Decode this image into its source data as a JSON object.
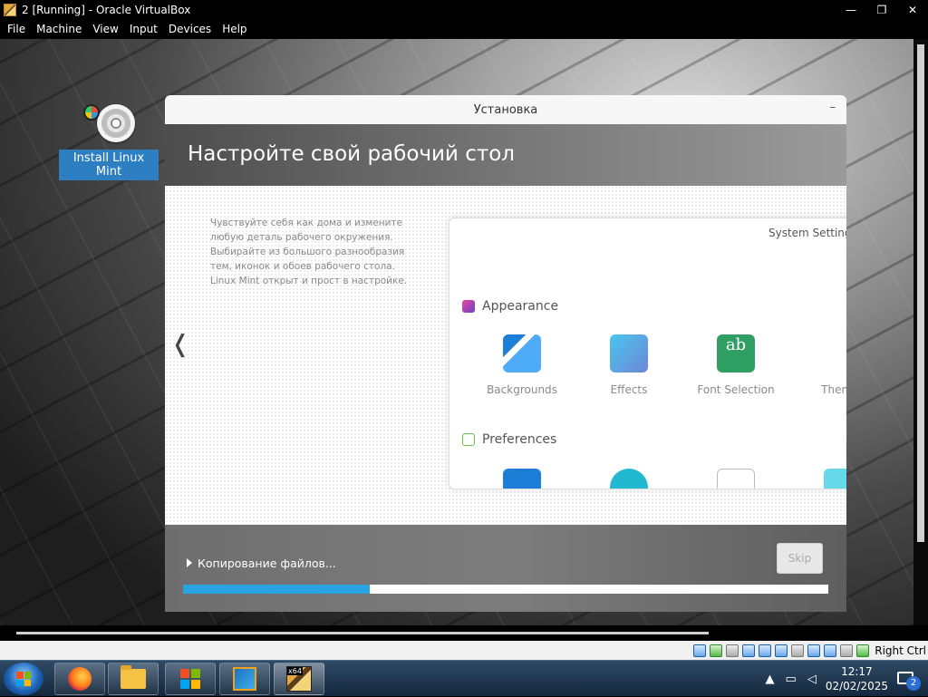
{
  "window": {
    "title": "2 [Running] - Oracle VirtualBox",
    "minimize_glyph": "—",
    "restore_glyph": "❐",
    "close_glyph": "✕"
  },
  "menu": [
    "File",
    "Machine",
    "View",
    "Input",
    "Devices",
    "Help"
  ],
  "desktop": {
    "icon_label": "Install Linux Mint",
    "icon_name": "cd-drive-icon"
  },
  "installer": {
    "window_title": "Установка",
    "minimize_glyph": "–",
    "heading": "Настройте свой рабочий стол",
    "description": "Чувствуйте себя как дома и измените любую деталь рабочего окружения. Выбирайте из большого разнообразия тем, иконок и обоев рабочего стола. Linux Mint открыт и прост в настройке.",
    "prev_glyph": "❬",
    "preview": {
      "title": "System Settings",
      "next_glyph": "❭",
      "section_appearance": "Appearance",
      "section_preferences": "Preferences",
      "items": [
        {
          "label": "Backgrounds",
          "icon": "backgrounds-icon"
        },
        {
          "label": "Effects",
          "icon": "effects-icon"
        },
        {
          "label": "Font Selection",
          "icon": "font-selection-icon"
        },
        {
          "label": "Themes",
          "icon": "themes-icon"
        }
      ]
    },
    "progress_text": "Копирование файлов...",
    "skip_label": "Skip",
    "progress_fraction": 0.29
  },
  "statusbar": {
    "host_key": "Right Ctrl"
  },
  "taskbar": {
    "apps": [
      "firefox-icon",
      "file-explorer-icon",
      "microsoft-store-icon",
      "virtualbox-icon",
      "virtualbox-vm-icon"
    ],
    "vm_badge": "x64",
    "time": "12:17",
    "date": "02/02/2025",
    "notification_count": "2"
  },
  "colors": {
    "accent": "#2aa3e0",
    "taskbar": "#1f3650"
  }
}
